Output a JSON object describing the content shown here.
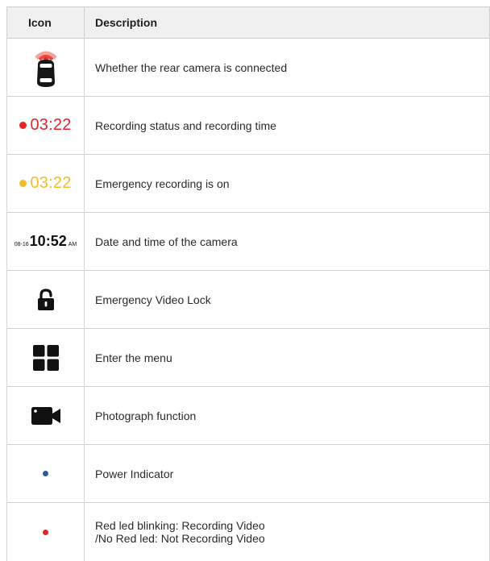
{
  "header": {
    "icon_col": "Icon",
    "desc_col": "Description"
  },
  "rows": [
    {
      "icon": "rear-camera-car-icon",
      "description": "Whether the rear camera is connected"
    },
    {
      "icon": "recording-time-indicator",
      "icon_text": "03:22",
      "color": "#e3262b",
      "description": "Recording status and recording time"
    },
    {
      "icon": "emergency-recording-indicator",
      "icon_text": "03:22",
      "color": "#f4bb2b",
      "description": "Emergency recording is on"
    },
    {
      "icon": "date-time-display",
      "date": "08-16",
      "time": "10:52",
      "ampm": "AM",
      "description": "Date and time of the camera"
    },
    {
      "icon": "padlock-icon",
      "description": "Emergency Video Lock"
    },
    {
      "icon": "grid-menu-icon",
      "description": "Enter the menu"
    },
    {
      "icon": "camera-icon",
      "description": "Photograph function"
    },
    {
      "icon": "blue-dot-icon",
      "color": "#2a5aa0",
      "description": "Power Indicator"
    },
    {
      "icon": "red-dot-icon",
      "color": "#e3262b",
      "description": "Red led blinking: Recording Video\n/No Red led: Not Recording Video"
    }
  ]
}
